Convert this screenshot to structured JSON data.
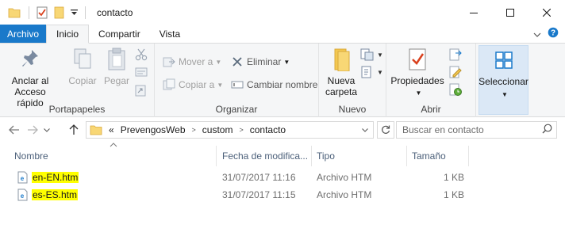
{
  "window": {
    "title": "contacto"
  },
  "ribbon_tabs": [
    "Archivo",
    "Inicio",
    "Compartir",
    "Vista"
  ],
  "groups": {
    "portapapeles": {
      "label": "Portapapeles",
      "anclar": "Anclar al\nAcceso rápido",
      "copiar": "Copiar",
      "pegar": "Pegar"
    },
    "organizar": {
      "label": "Organizar",
      "mover": "Mover a",
      "copiar_a": "Copiar a",
      "eliminar": "Eliminar",
      "cambiar_nombre": "Cambiar nombre"
    },
    "nuevo": {
      "label": "Nuevo",
      "nueva_carpeta": "Nueva\ncarpeta"
    },
    "abrir": {
      "label": "Abrir",
      "propiedades": "Propiedades"
    },
    "seleccionar": {
      "label": "Seleccionar"
    }
  },
  "address": {
    "prefix": "«",
    "segments": [
      "PrevengosWeb",
      "custom",
      "contacto"
    ],
    "search_placeholder": "Buscar en contacto"
  },
  "columns": {
    "name": "Nombre",
    "date": "Fecha de modifica...",
    "type": "Tipo",
    "size": "Tamaño"
  },
  "files": [
    {
      "name": "en-EN.htm",
      "date": "31/07/2017 11:16",
      "type": "Archivo HTM",
      "size": "1 KB"
    },
    {
      "name": "es-ES.htm",
      "date": "31/07/2017 11:15",
      "type": "Archivo HTM",
      "size": "1 KB"
    }
  ],
  "colors": {
    "file_tab": "#1979ca",
    "highlight": "#ffff00",
    "column_header": "#4c607a",
    "select_group": "#dbe8f6"
  }
}
